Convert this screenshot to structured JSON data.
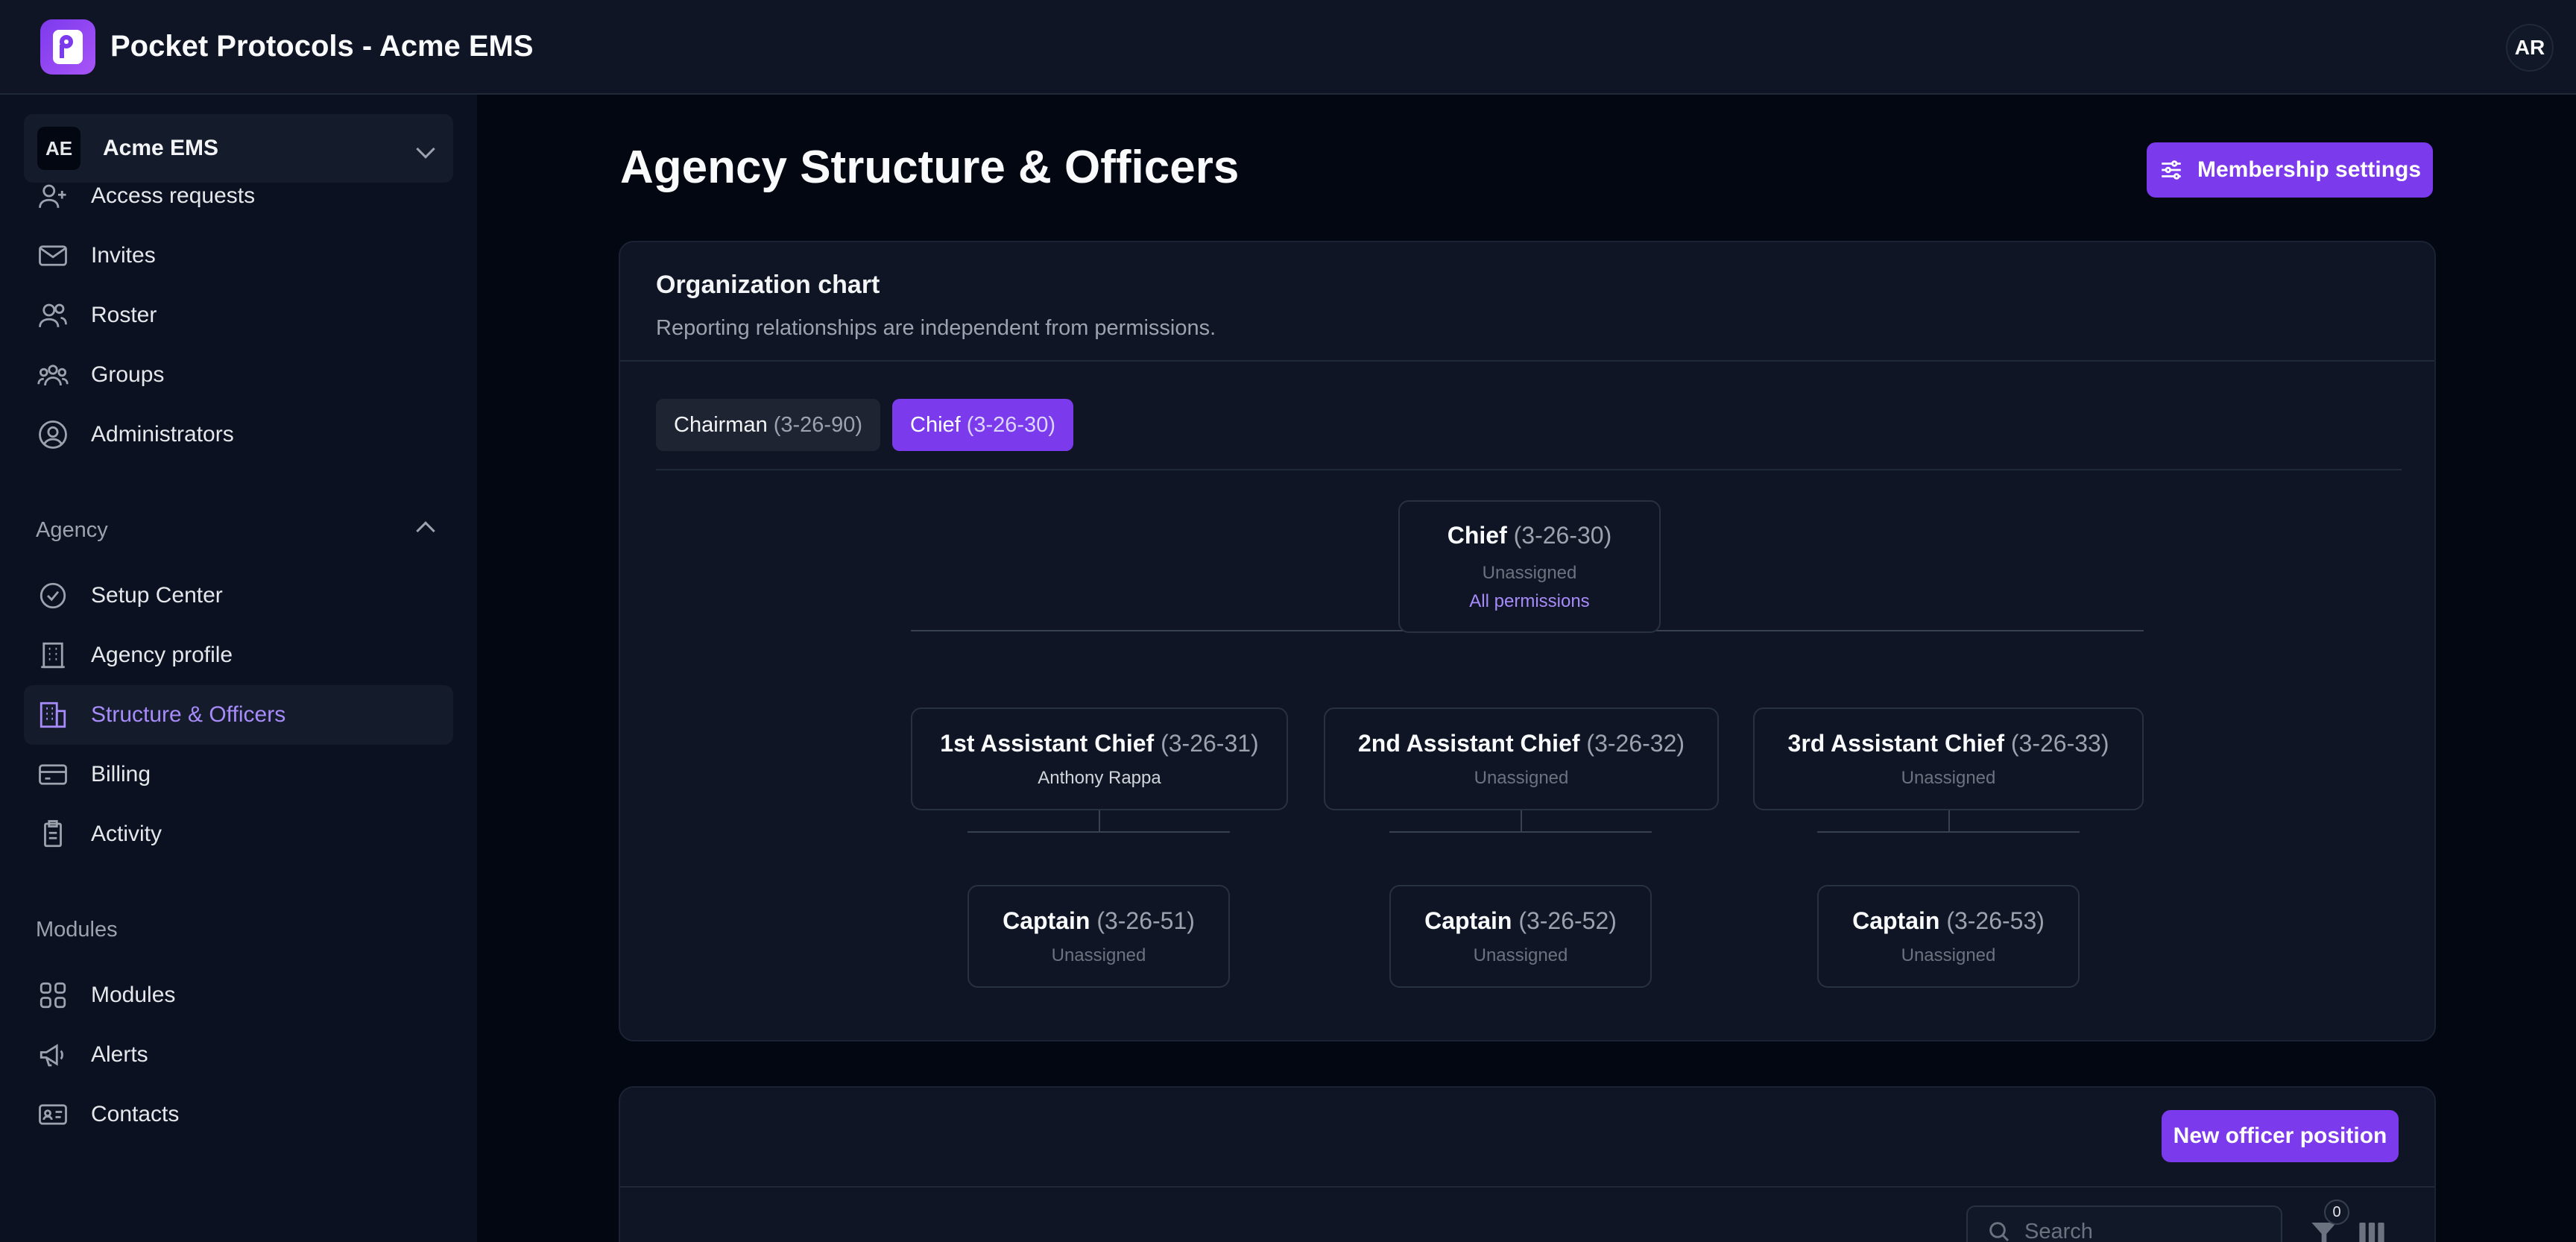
{
  "app": {
    "title": "Pocket Protocols - Acme EMS",
    "user_initials": "AR"
  },
  "org_switcher": {
    "initials": "AE",
    "name": "Acme EMS"
  },
  "sidebar": {
    "people_items": [
      {
        "label": "Access requests",
        "icon": "user-plus-icon"
      },
      {
        "label": "Invites",
        "icon": "envelope-icon"
      },
      {
        "label": "Roster",
        "icon": "users-icon"
      },
      {
        "label": "Groups",
        "icon": "user-group-icon"
      },
      {
        "label": "Administrators",
        "icon": "user-circle-icon"
      }
    ],
    "agency_section": "Agency",
    "agency_items": [
      {
        "label": "Setup Center",
        "icon": "check-circle-icon"
      },
      {
        "label": "Agency profile",
        "icon": "building-icon"
      },
      {
        "label": "Structure & Officers",
        "icon": "building-office-icon",
        "active": true
      },
      {
        "label": "Billing",
        "icon": "credit-card-icon"
      },
      {
        "label": "Activity",
        "icon": "clipboard-icon"
      }
    ],
    "modules_section": "Modules",
    "modules_items": [
      {
        "label": "Modules",
        "icon": "grid-icon"
      },
      {
        "label": "Alerts",
        "icon": "megaphone-icon"
      },
      {
        "label": "Contacts",
        "icon": "identification-icon"
      }
    ]
  },
  "page": {
    "title": "Agency Structure & Officers",
    "membership_button": "Membership settings"
  },
  "org_chart": {
    "title": "Organization chart",
    "subtitle": "Reporting relationships are independent from permissions.",
    "tabs": [
      {
        "name": "Chairman",
        "code": "(3-26-90)",
        "active": false
      },
      {
        "name": "Chief",
        "code": "(3-26-30)",
        "active": true
      }
    ],
    "root": {
      "name": "Chief",
      "code": "(3-26-30)",
      "holder": "Unassigned",
      "permissions": "All permissions"
    },
    "level2": [
      {
        "name": "1st Assistant Chief",
        "code": "(3-26-31)",
        "holder": "Anthony Rappa"
      },
      {
        "name": "2nd Assistant Chief",
        "code": "(3-26-32)",
        "holder": "Unassigned"
      },
      {
        "name": "3rd Assistant Chief",
        "code": "(3-26-33)",
        "holder": "Unassigned"
      }
    ],
    "level3": [
      {
        "name": "Captain",
        "code": "(3-26-51)",
        "holder": "Unassigned"
      },
      {
        "name": "Captain",
        "code": "(3-26-52)",
        "holder": "Unassigned"
      },
      {
        "name": "Captain",
        "code": "(3-26-53)",
        "holder": "Unassigned"
      }
    ]
  },
  "officers": {
    "new_button": "New officer position",
    "search_placeholder": "Search",
    "filter_count": "0"
  }
}
